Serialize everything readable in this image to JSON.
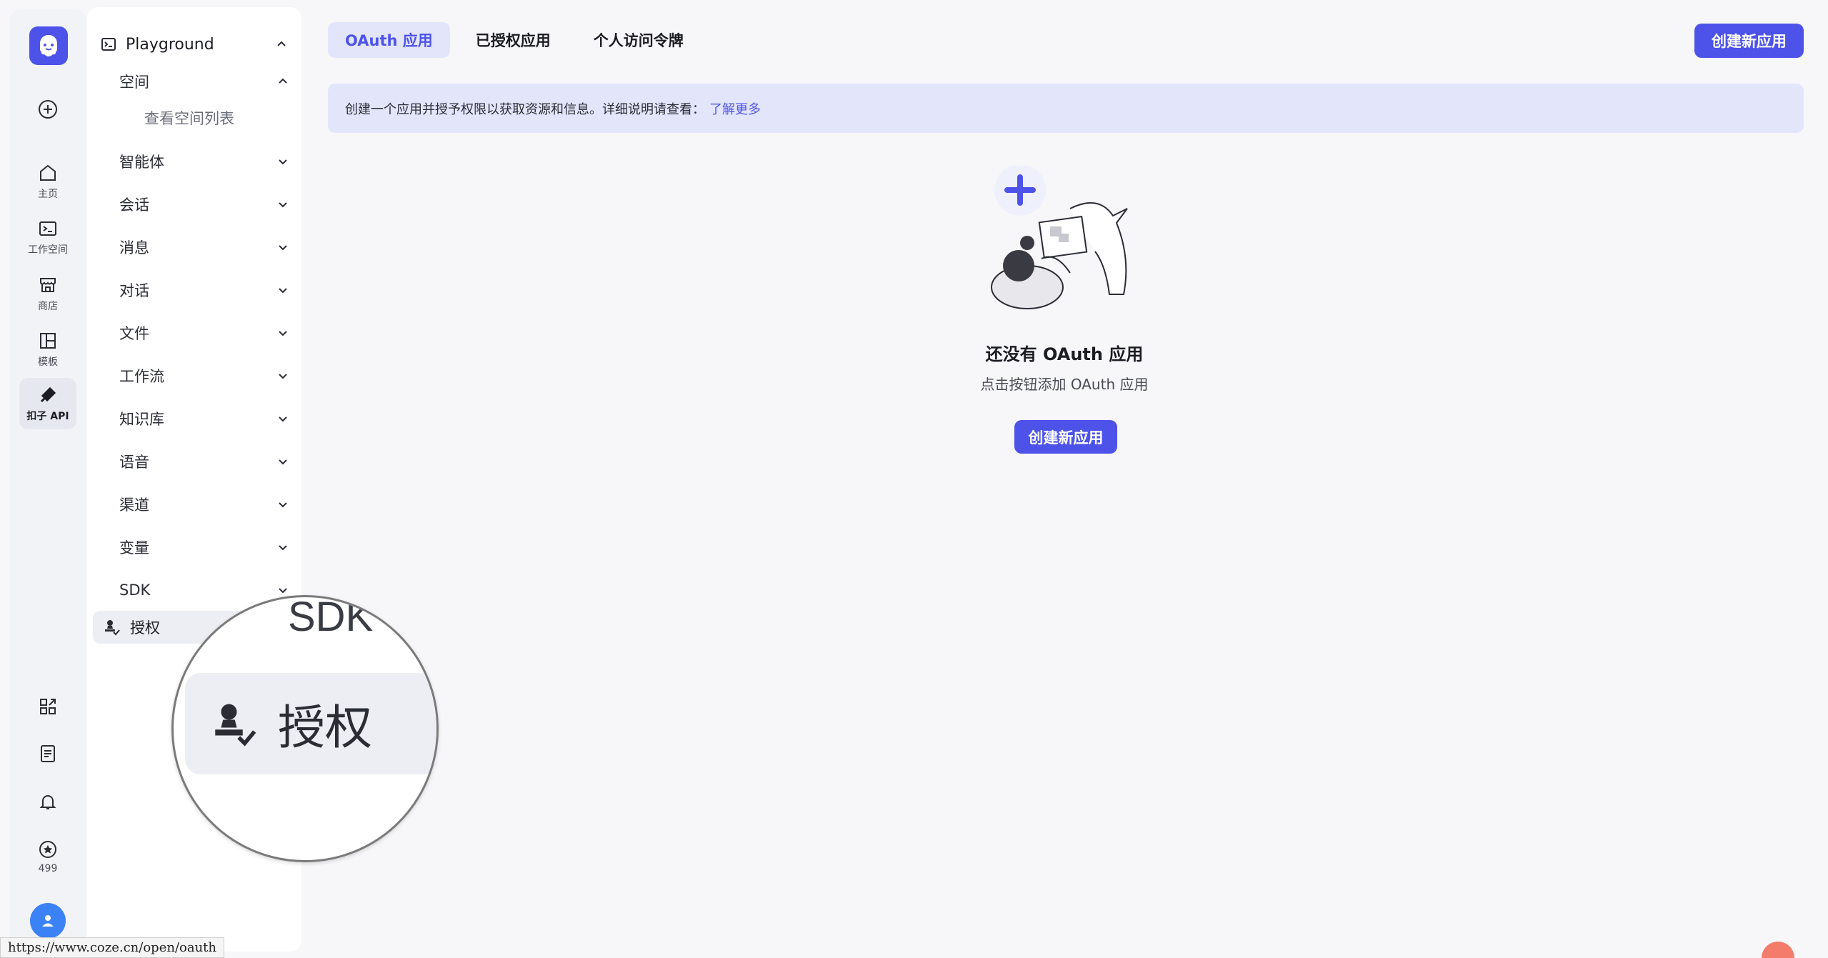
{
  "rail": {
    "items": [
      {
        "label": "",
        "icon": "plus-circle-icon"
      },
      {
        "label": "主页",
        "icon": "home-icon"
      },
      {
        "label": "工作空间",
        "icon": "terminal-icon"
      },
      {
        "label": "商店",
        "icon": "store-icon"
      },
      {
        "label": "模板",
        "icon": "layout-icon"
      },
      {
        "label": "扣子 API",
        "icon": "plug-icon",
        "active": true
      }
    ],
    "bottom": {
      "points": "499"
    }
  },
  "nav": {
    "top": "Playground",
    "space": "空间",
    "space_sub": "查看空间列表",
    "items": [
      "智能体",
      "会话",
      "消息",
      "对话",
      "文件",
      "工作流",
      "知识库",
      "语音",
      "渠道",
      "变量",
      "SDK"
    ],
    "auth": "授权"
  },
  "magnifier": {
    "sdk": "SDK",
    "auth": "授权"
  },
  "tabs": [
    "OAuth 应用",
    "已授权应用",
    "个人访问令牌"
  ],
  "create_button": "创建新应用",
  "banner": {
    "text": "创建一个应用并授予权限以获取资源和信息。详细说明请查看：",
    "link": "了解更多"
  },
  "empty": {
    "title": "还没有 OAuth 应用",
    "subtitle": "点击按钮添加 OAuth 应用",
    "button": "创建新应用"
  },
  "status_url": "https://www.coze.cn/open/oauth",
  "colors": {
    "accent": "#4d53e8",
    "accent_bg": "#e3e5fb"
  }
}
